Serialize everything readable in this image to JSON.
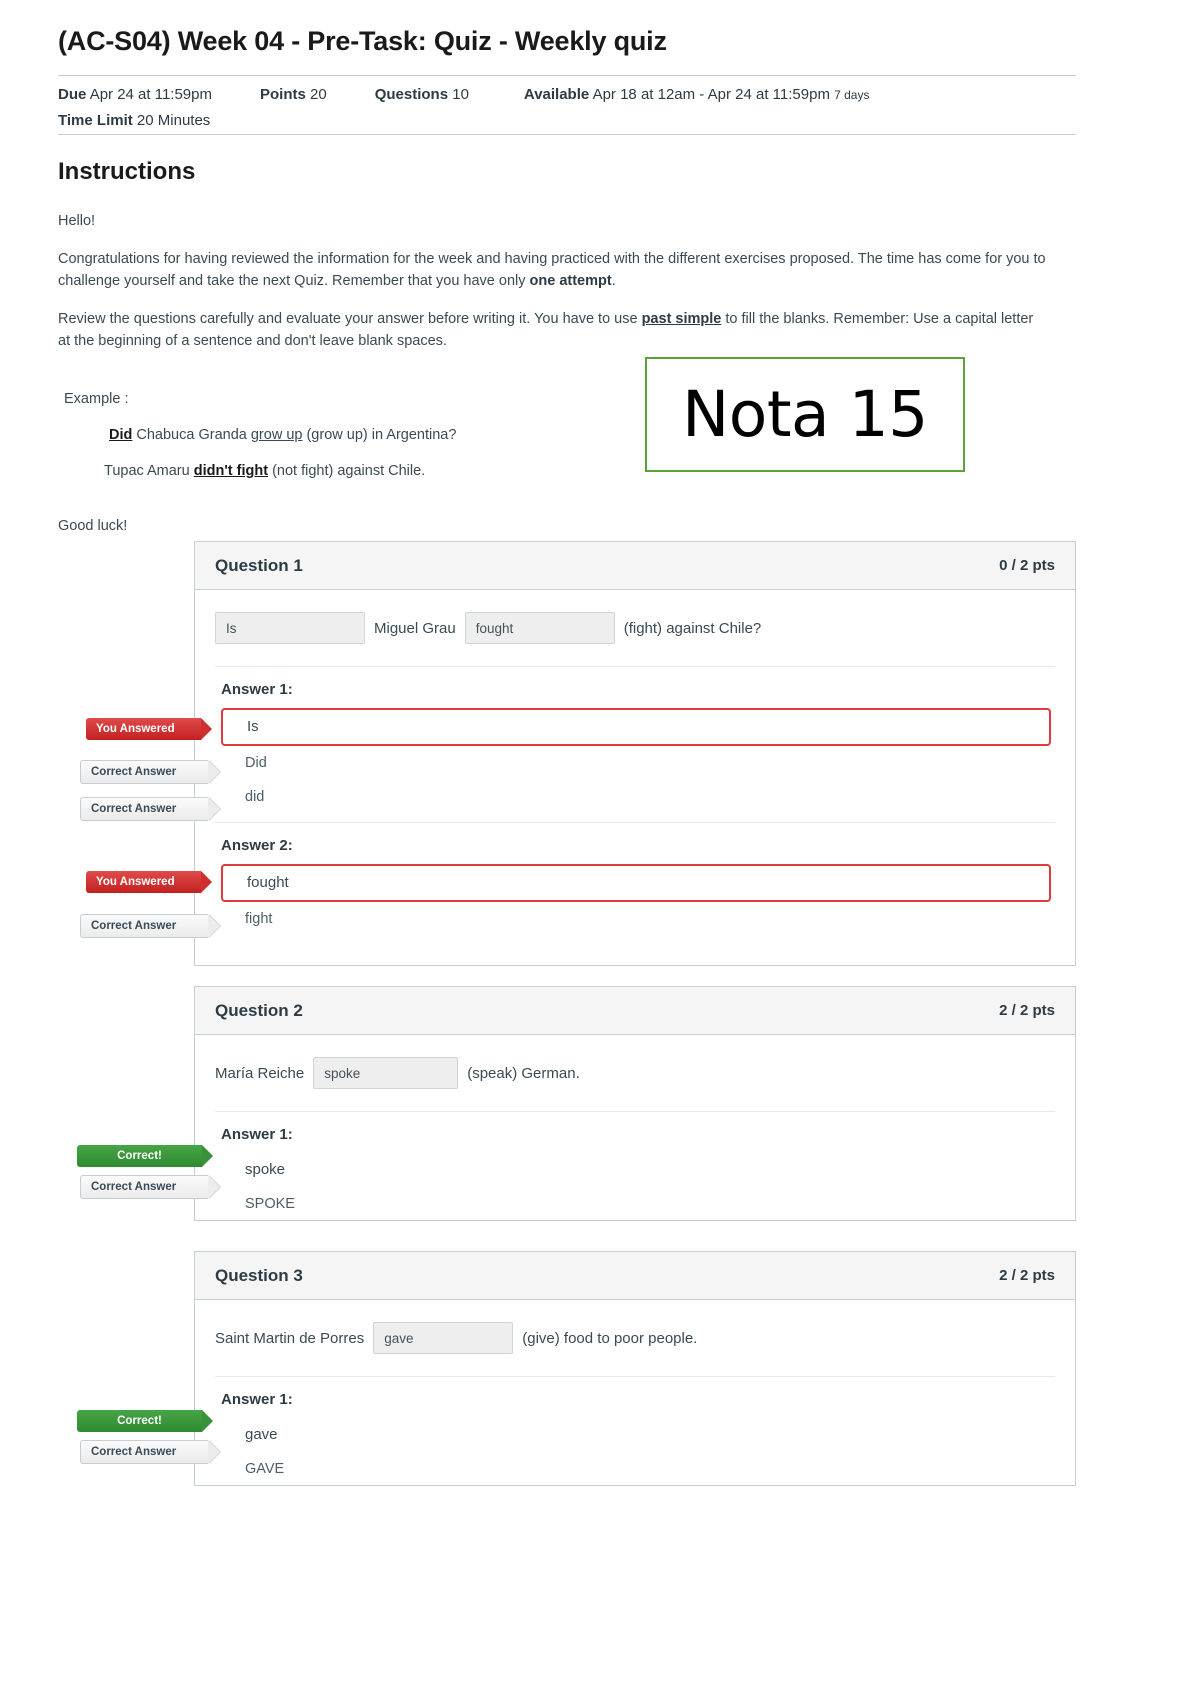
{
  "page": {
    "title": "(AC-S04) Week 04 - Pre-Task: Quiz - Weekly quiz"
  },
  "meta": {
    "due_label": "Due",
    "due_value": "Apr 24 at 11:59pm",
    "points_label": "Points",
    "points_value": "20",
    "questions_label": "Questions",
    "questions_value": "10",
    "available_label": "Available",
    "available_value": "Apr 18 at 12am - Apr 24 at 11:59pm",
    "available_days": "7 days",
    "time_limit_label": "Time Limit",
    "time_limit_value": "20 Minutes"
  },
  "instructions": {
    "heading": "Instructions",
    "p1": "Hello!",
    "p2_a": "Congratulations for having reviewed the information for the week and having practiced with the different exercises proposed. The time has come for you to challenge yourself and take the next Quiz. Remember that you have only ",
    "p2_bold": "one attempt",
    "p2_b": ".",
    "p3_a": "Review the questions carefully and evaluate your answer before writing it. You have to use ",
    "p3_link": "past simple",
    "p3_b": " to fill the blanks. Remember: Use a capital letter at the beginning of a sentence and don't leave blank spaces.",
    "example_label": "Example :",
    "example1_bold": "Did",
    "example1_mid": " Chabuca Granda ",
    "example1_u": "grow up",
    "example1_end": " (grow up) in Argentina?",
    "example2_start": "Tupac Amaru ",
    "example2_bold": "didn't fight",
    "example2_end": " (not fight) against Chile.",
    "good_luck": "Good luck!"
  },
  "annotation": {
    "nota_text": "Nota 15",
    "border_color": "#5aa334"
  },
  "labels": {
    "answer1": "Answer 1:",
    "answer2": "Answer 2:",
    "you_answered": "You Answered",
    "correct_answer": "Correct Answer",
    "correct": "Correct!"
  },
  "colors": {
    "incorrect_red": "#c22020",
    "correct_green": "#2f8a2f",
    "header_bg": "#f5f5f5",
    "border": "#c7cdd1"
  },
  "questions": [
    {
      "name": "Question 1",
      "points": "0 / 2 pts",
      "prompt": {
        "blank1": "Is",
        "mid": "Miguel Grau",
        "blank2": "fought",
        "tail": "(fight) against Chile?"
      },
      "answers": [
        {
          "label": "Answer 1:",
          "your_answer": "Is",
          "your_status": "incorrect",
          "correct_answers": [
            "Did",
            "did"
          ]
        },
        {
          "label": "Answer 2:",
          "your_answer": "fought",
          "your_status": "incorrect",
          "correct_answers": [
            "fight"
          ]
        }
      ]
    },
    {
      "name": "Question 2",
      "points": "2 / 2 pts",
      "prompt": {
        "lead": "María Reiche",
        "blank1": "spoke",
        "tail": "(speak) German."
      },
      "answers": [
        {
          "label": "Answer 1:",
          "your_answer": "spoke",
          "your_status": "correct",
          "correct_answers": [
            "SPOKE"
          ]
        }
      ]
    },
    {
      "name": "Question 3",
      "points": "2 / 2 pts",
      "prompt": {
        "lead": "Saint Martin de Porres",
        "blank1": "gave",
        "tail": "(give) food to poor people."
      },
      "answers": [
        {
          "label": "Answer 1:",
          "your_answer": "gave",
          "your_status": "correct",
          "correct_answers": [
            "GAVE"
          ]
        }
      ]
    }
  ]
}
